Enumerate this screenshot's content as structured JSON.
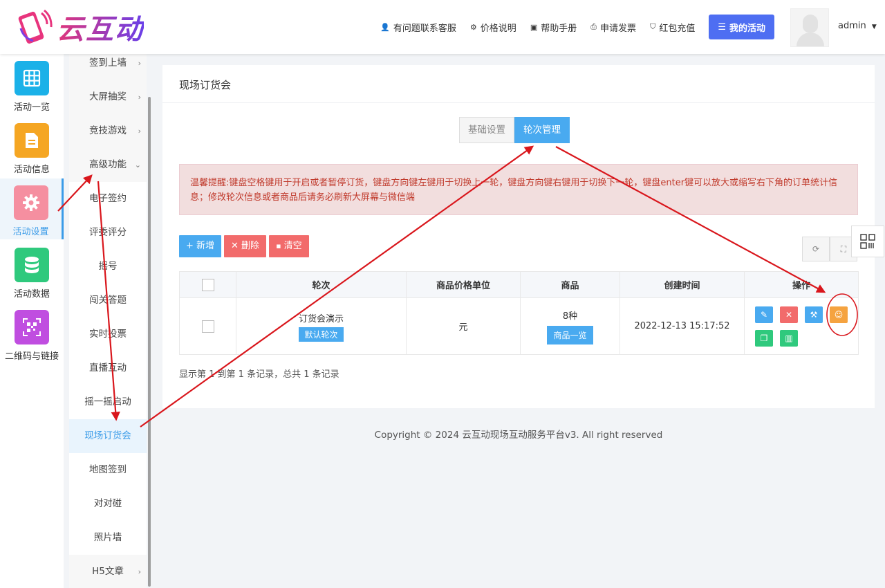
{
  "brand": {
    "name": "云互动"
  },
  "header": {
    "nav": [
      {
        "label": "有问题联系客服",
        "icon": "user-plus-icon"
      },
      {
        "label": "价格说明",
        "icon": "gear-icon"
      },
      {
        "label": "帮助手册",
        "icon": "book-icon"
      },
      {
        "label": "申请发票",
        "icon": "printer-icon"
      },
      {
        "label": "红包充值",
        "icon": "shield-check-icon"
      }
    ],
    "cta_label": "我的活动",
    "user": "admin"
  },
  "rail": [
    {
      "label": "活动一览",
      "color": "#1bb1e8",
      "icon": "grid-icon"
    },
    {
      "label": "活动信息",
      "color": "#f5a623",
      "icon": "document-icon"
    },
    {
      "label": "活动设置",
      "color": "#f58fa0",
      "icon": "gear-icon",
      "active": true
    },
    {
      "label": "活动数据",
      "color": "#2fc97d",
      "icon": "database-icon"
    },
    {
      "label": "二维码与链接",
      "color": "#c04ee0",
      "icon": "qrcode-icon"
    }
  ],
  "submenu": [
    {
      "label": "签到上墙",
      "chev": "›"
    },
    {
      "label": "大屏抽奖",
      "chev": "›"
    },
    {
      "label": "竞技游戏",
      "chev": "›"
    },
    {
      "label": "高级功能",
      "chev": "⌄"
    },
    {
      "label": "电子签约"
    },
    {
      "label": "评委评分"
    },
    {
      "label": "摇号"
    },
    {
      "label": "闯关答题"
    },
    {
      "label": "实时投票"
    },
    {
      "label": "直播互动"
    },
    {
      "label": "摇一摇启动"
    },
    {
      "label": "现场订货会",
      "active": true
    },
    {
      "label": "地图签到"
    },
    {
      "label": "对对碰"
    },
    {
      "label": "照片墙"
    },
    {
      "label": "H5文章",
      "chev": "›"
    }
  ],
  "page": {
    "title": "现场订货会",
    "tabs": [
      "基础设置",
      "轮次管理"
    ],
    "alert": "温馨提醒:键盘空格键用于开启或者暂停订货，键盘方向键左键用于切换上一轮，键盘方向键右键用于切换下一轮，键盘enter键可以放大或缩写右下角的订单统计信息；修改轮次信息或者商品后请务必刷新大屏幕与微信端",
    "buttons": {
      "add": "+ 新增",
      "delete": "✕ 删除",
      "clear": "清空"
    },
    "table": {
      "headers": [
        "轮次",
        "商品价格单位",
        "商品",
        "创建时间",
        "操作"
      ],
      "rows": [
        {
          "name": "订货会演示",
          "badge": "默认轮次",
          "unit": "元",
          "goods_count": "8种",
          "goods_btn": "商品一览",
          "created": "2022-12-13 15:17:52"
        }
      ]
    },
    "pagination": "显示第 1 到第 1 条记录，总共 1 条记录"
  },
  "footer": {
    "copyright": "Copyright © 2024 云互动现场互动服务平台v3. All right reserved"
  }
}
